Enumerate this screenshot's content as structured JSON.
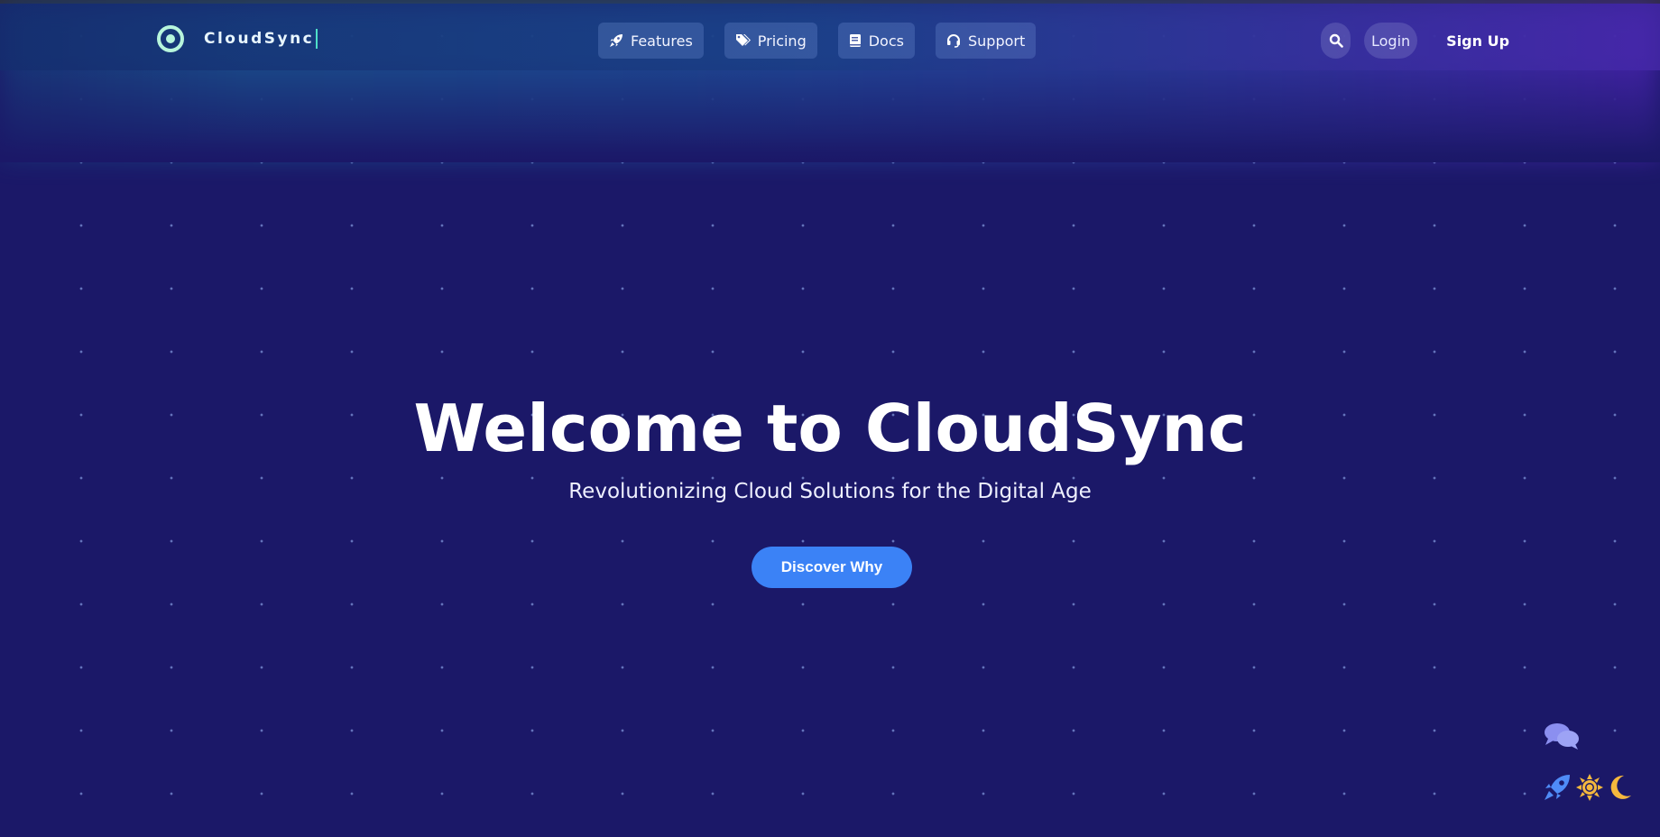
{
  "colors": {
    "background": "#1b1868",
    "accent": "#3b82f6",
    "logo_mint": "#b7f5dc",
    "caret": "#4ee0c8"
  },
  "nav": {
    "logo_text": "CloudSync",
    "links": [
      {
        "label": "Features",
        "icon": "rocket-icon"
      },
      {
        "label": "Pricing",
        "icon": "tags-icon"
      },
      {
        "label": "Docs",
        "icon": "book-icon"
      },
      {
        "label": "Support",
        "icon": "headset-icon"
      }
    ],
    "search_icon": "search-icon",
    "login_label": "Login",
    "signup_label": "Sign Up"
  },
  "hero": {
    "title": "Welcome to CloudSync",
    "subtitle": "Revolutionizing Cloud Solutions for the Digital Age",
    "cta_label": "Discover Why"
  },
  "floating_widgets": {
    "chat_icon": "comments-icon",
    "icons": [
      "rocket-icon",
      "sun-icon",
      "moon-icon"
    ]
  }
}
